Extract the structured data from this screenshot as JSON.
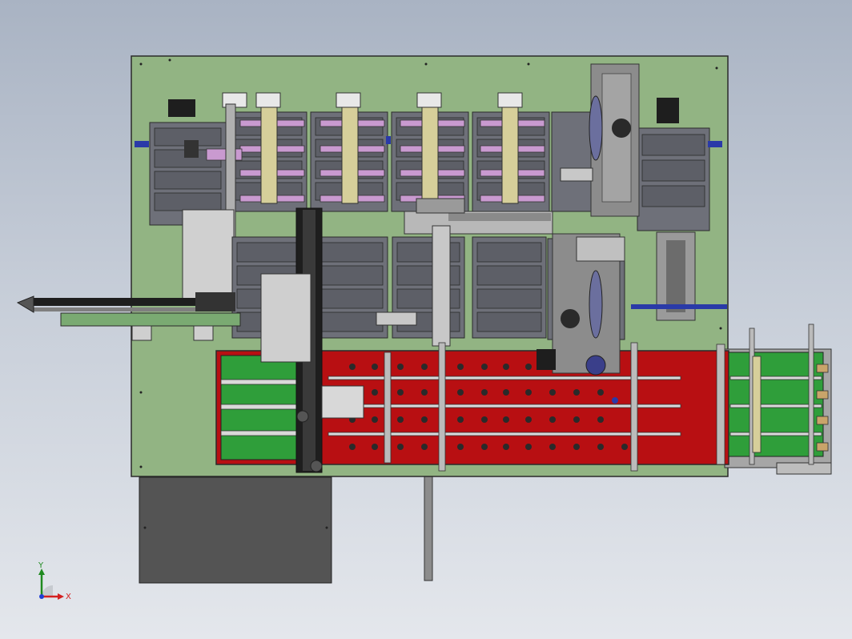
{
  "viewport": {
    "palette": {
      "background_top": "#a9b3c3",
      "background_bottom": "#e4e7ec",
      "base_plate": "#92b483",
      "table_red": "#b80f12",
      "green_zone": "#2f9e3a",
      "tray_gray": "#6e7079",
      "rail_dark": "#1e1e1e",
      "pink_clamp": "#c99ad0",
      "tan_arm": "#d6cf9a",
      "cabinet": "#545454",
      "blue_accent": "#2a3aa8"
    }
  },
  "triad": {
    "x_label": "X",
    "y_label": "Y",
    "x_color": "#d42020",
    "y_color": "#1f8a1f",
    "z_color": "#1f3fd4"
  }
}
